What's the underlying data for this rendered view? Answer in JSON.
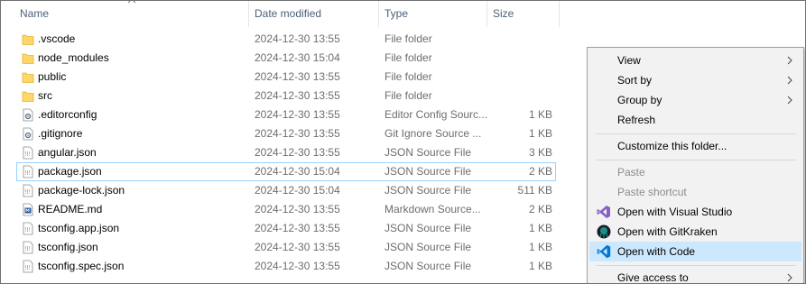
{
  "columns": {
    "name": "Name",
    "date": "Date modified",
    "type": "Type",
    "size": "Size"
  },
  "files": [
    {
      "name": ".vscode",
      "date": "2024-12-30 13:55",
      "type": "File folder",
      "size": "",
      "icon": "folder-icon"
    },
    {
      "name": "node_modules",
      "date": "2024-12-30 15:04",
      "type": "File folder",
      "size": "",
      "icon": "folder-icon"
    },
    {
      "name": "public",
      "date": "2024-12-30 13:55",
      "type": "File folder",
      "size": "",
      "icon": "folder-icon"
    },
    {
      "name": "src",
      "date": "2024-12-30 13:55",
      "type": "File folder",
      "size": "",
      "icon": "folder-icon"
    },
    {
      "name": ".editorconfig",
      "date": "2024-12-30 13:55",
      "type": "Editor Config Sourc...",
      "size": "1 KB",
      "icon": "gear-file-icon"
    },
    {
      "name": ".gitignore",
      "date": "2024-12-30 13:55",
      "type": "Git Ignore Source ...",
      "size": "1 KB",
      "icon": "gear-file-icon"
    },
    {
      "name": "angular.json",
      "date": "2024-12-30 13:55",
      "type": "JSON Source File",
      "size": "3 KB",
      "icon": "json-file-icon"
    },
    {
      "name": "package.json",
      "date": "2024-12-30 15:04",
      "type": "JSON Source File",
      "size": "2 KB",
      "icon": "json-file-icon"
    },
    {
      "name": "package-lock.json",
      "date": "2024-12-30 15:04",
      "type": "JSON Source File",
      "size": "511 KB",
      "icon": "json-file-icon"
    },
    {
      "name": "README.md",
      "date": "2024-12-30 13:55",
      "type": "Markdown Source...",
      "size": "2 KB",
      "icon": "markdown-file-icon"
    },
    {
      "name": "tsconfig.app.json",
      "date": "2024-12-30 13:55",
      "type": "JSON Source File",
      "size": "1 KB",
      "icon": "json-file-icon"
    },
    {
      "name": "tsconfig.json",
      "date": "2024-12-30 13:55",
      "type": "JSON Source File",
      "size": "1 KB",
      "icon": "json-file-icon"
    },
    {
      "name": "tsconfig.spec.json",
      "date": "2024-12-30 13:55",
      "type": "JSON Source File",
      "size": "1 KB",
      "icon": "json-file-icon"
    }
  ],
  "selected_file": "package.json",
  "context_menu": {
    "view": "View",
    "sort_by": "Sort by",
    "group_by": "Group by",
    "refresh": "Refresh",
    "customize": "Customize this folder...",
    "paste": "Paste",
    "paste_shortcut": "Paste shortcut",
    "open_visual_studio": "Open with Visual Studio",
    "open_gitkraken": "Open with GitKraken",
    "open_code": "Open with Code",
    "give_access": "Give access to"
  },
  "colors": {
    "header_text": "#4c607a",
    "selection_border": "#99d1ff",
    "menu_highlight": "#cce8ff",
    "folder": "#ffd766",
    "visual_studio": "#8661c5",
    "vscode": "#0078d4",
    "gitkraken": "#179287"
  }
}
